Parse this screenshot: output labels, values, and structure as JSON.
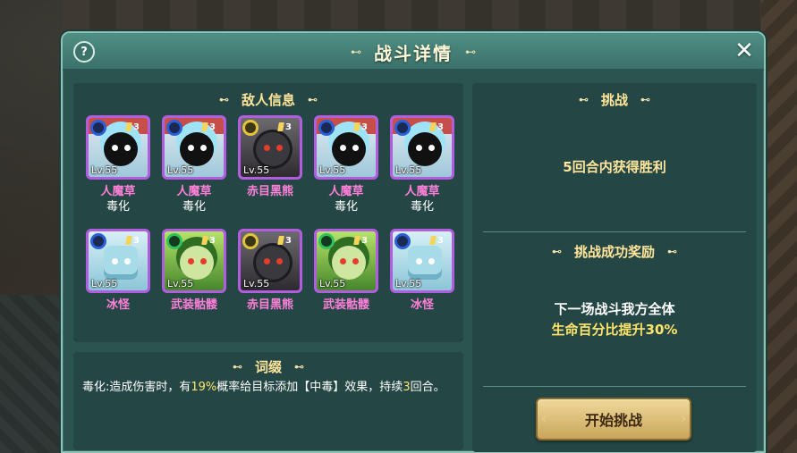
{
  "header": {
    "title": "战斗详情",
    "help_label": "?",
    "close_label": "✕",
    "ornament": "⊷"
  },
  "enemy_section": {
    "title": "敌人信息",
    "enemies": [
      {
        "name": "人魔草",
        "trait": "毒化",
        "level": "Lv.55",
        "stars": "3",
        "kind": "mandrake",
        "element": "blue"
      },
      {
        "name": "人魔草",
        "trait": "毒化",
        "level": "Lv.55",
        "stars": "3",
        "kind": "mandrake",
        "element": "blue"
      },
      {
        "name": "赤目黑熊",
        "trait": "",
        "level": "Lv.55",
        "stars": "3",
        "kind": "bear",
        "element": "yellow"
      },
      {
        "name": "人魔草",
        "trait": "毒化",
        "level": "Lv.55",
        "stars": "3",
        "kind": "mandrake",
        "element": "blue"
      },
      {
        "name": "人魔草",
        "trait": "毒化",
        "level": "Lv.55",
        "stars": "3",
        "kind": "mandrake",
        "element": "blue"
      },
      {
        "name": "冰怪",
        "trait": "",
        "level": "Lv.55",
        "stars": "3",
        "kind": "ice",
        "element": "blue"
      },
      {
        "name": "武装骷髅",
        "trait": "",
        "level": "Lv.55",
        "stars": "3",
        "kind": "skeleton",
        "element": "green"
      },
      {
        "name": "赤目黑熊",
        "trait": "",
        "level": "Lv.55",
        "stars": "3",
        "kind": "bear",
        "element": "yellow"
      },
      {
        "name": "武装骷髅",
        "trait": "",
        "level": "Lv.55",
        "stars": "3",
        "kind": "skeleton",
        "element": "green"
      },
      {
        "name": "冰怪",
        "trait": "",
        "level": "Lv.55",
        "stars": "3",
        "kind": "ice",
        "element": "blue"
      }
    ]
  },
  "affix_section": {
    "title": "词缀",
    "text_a": "毒化:造成伤害时，有",
    "text_pct": "19%",
    "text_b": "概率给目标添加【中毒】效果，持续",
    "text_turns": "3",
    "text_c": "回合。"
  },
  "challenge_section": {
    "title": "挑战",
    "goal": "5回合内获得胜利",
    "reward_title": "挑战成功奖励",
    "reward_line1": "下一场战斗我方全体",
    "reward_line2": "生命百分比提升30%",
    "start_button": "开始挑战"
  },
  "colors": {
    "panel_bg": "#2b5450",
    "name_pink": "#ff7fd9",
    "highlight_yellow": "#ffe46a",
    "rarity_purple": "#b25de0"
  }
}
